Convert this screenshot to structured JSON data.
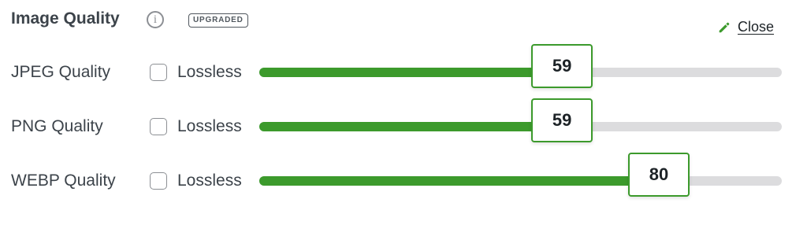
{
  "header": {
    "title": "Image Quality",
    "info_icon": "info-icon",
    "badge": "UPGRADED",
    "close_label": "Close",
    "close_icon": "pencil-icon"
  },
  "colors": {
    "accent": "#3c9a2c",
    "track": "#dcdcde",
    "text": "#3c434a"
  },
  "slider_range": [
    0,
    100
  ],
  "rows": [
    {
      "label": "JPEG Quality",
      "lossless_label": "Lossless",
      "lossless_checked": false,
      "value": 59
    },
    {
      "label": "PNG Quality",
      "lossless_label": "Lossless",
      "lossless_checked": false,
      "value": 59
    },
    {
      "label": "WEBP Quality",
      "lossless_label": "Lossless",
      "lossless_checked": false,
      "value": 80
    }
  ]
}
